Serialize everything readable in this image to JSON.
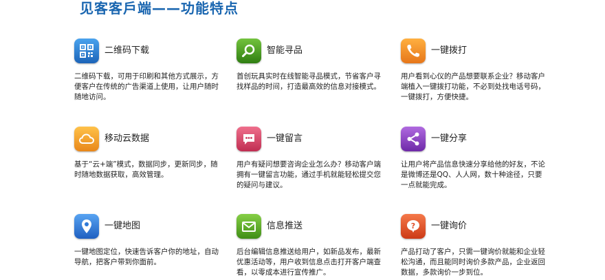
{
  "title": "见客客戶端——功能特点",
  "features": [
    {
      "name": "二维码下载",
      "icon": "qr-code-icon",
      "color": "#2d7fd3",
      "desc": "二维码下载，可用于印刷和其他方式展示，方便客户在传统的广告渠道上使用，让用户随时随地访问。"
    },
    {
      "name": "智能寻品",
      "icon": "magnifier-icon",
      "color": "#4a9e20",
      "desc": "首创玩具实时在线智能寻品模式，节省客户寻找样品的时间，打造最高效的信息对接模式。"
    },
    {
      "name": "一键拨打",
      "icon": "phone-icon",
      "color": "#f08c1a",
      "desc": "用户看到心仪的产品想要联系企业？移动客户端植入一键拨打功能，不必到处找电话号码，一键拨打，方便快捷。"
    },
    {
      "name": "移动云数据",
      "icon": "cloud-icon",
      "color": "#f0a020",
      "desc": "基于“云+端”模式，数据同步，更新同步，随时随地数据获取，高效管理。"
    },
    {
      "name": "一键留言",
      "icon": "chat-bubble-icon",
      "color": "#d8496a",
      "desc": "用户有疑问想要咨询企业怎么办？移动客户端拥有一键留言功能，通过手机就能轻松提交您的疑问与建议。"
    },
    {
      "name": "一键分享",
      "icon": "share-icon",
      "color": "#8a3fc0",
      "desc": "让用户将产品信息快速分享给他的好友，不论是微博还是QQ、人人网，数十种途径，只要一点就能完成。"
    },
    {
      "name": "一键地图",
      "icon": "map-pin-icon",
      "color": "#2f7ad8",
      "desc": "一键地图定位，快速告诉客户你的地址，自动导航，把客户带到你面前。"
    },
    {
      "name": "信息推送",
      "icon": "envelope-icon",
      "color": "#5aa62a",
      "desc": "后台编辑信息推送给用户，如新品发布，最新优惠活动等，用户收到信息点击打开客户端查看，以零成本进行宣传推广。"
    },
    {
      "name": "一键询价",
      "icon": "question-bubble-icon",
      "color": "#e8552a",
      "desc": "产品打动了客户，只需一键询价就能和企业轻松沟通，而且能同时询价多款产品，企业返回数据，多款询价一步到位。"
    }
  ]
}
